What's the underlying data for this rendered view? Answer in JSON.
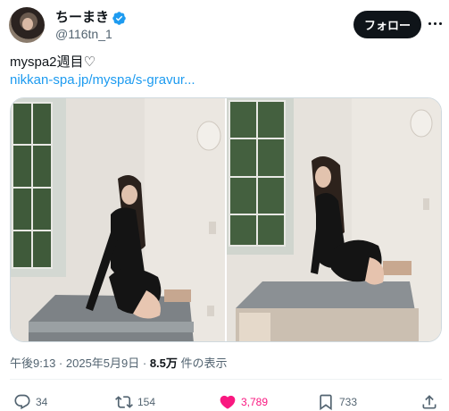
{
  "author": {
    "display_name": "ちーまき",
    "handle": "@116tn_1",
    "verified": true
  },
  "follow_label": "フォロー",
  "tweet": {
    "text": "myspa2週目♡",
    "link": "nikkan-spa.jp/myspa/s-gravur..."
  },
  "meta": {
    "time": "午後9:13",
    "separator": " · ",
    "date": "2025年5月9日",
    "views_count": "8.5万",
    "views_label": "件の表示"
  },
  "actions": {
    "replies": "34",
    "retweets": "154",
    "likes": "3,789",
    "bookmarks": "733"
  },
  "colors": {
    "accent": "#1d9bf0",
    "like": "#f91880",
    "text": "#0f1419",
    "muted": "#536471"
  }
}
